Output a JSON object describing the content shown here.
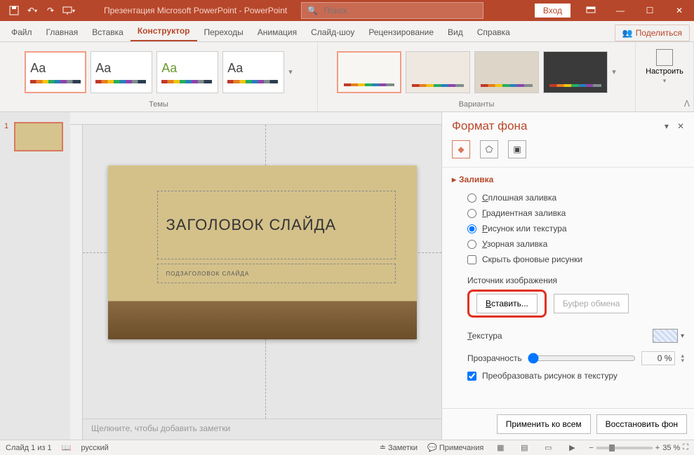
{
  "titlebar": {
    "doc_title": "Презентация Microsoft PowerPoint - PowerPoint",
    "search_placeholder": "Поиск",
    "login": "Вход"
  },
  "tabs": {
    "file": "Файл",
    "home": "Главная",
    "insert": "Вставка",
    "design": "Конструктор",
    "transitions": "Переходы",
    "animations": "Анимация",
    "slideshow": "Слайд-шоу",
    "review": "Рецензирование",
    "view": "Вид",
    "help": "Справка",
    "share": "Поделиться"
  },
  "ribbon": {
    "themes_label": "Темы",
    "variants_label": "Варианты",
    "configure": "Настроить",
    "aa": "Aa"
  },
  "slide": {
    "title": "ЗАГОЛОВОК СЛАЙДА",
    "subtitle": "ПОДЗАГОЛОВОК СЛАЙДА"
  },
  "thumbs": {
    "n1": "1"
  },
  "notes_placeholder": "Щелкните, чтобы добавить заметки",
  "pane": {
    "title": "Формат фона",
    "section_fill": "Заливка",
    "solid": "Сплошная заливка",
    "gradient": "Градиентная заливка",
    "picture": "Рисунок или текстура",
    "pattern": "Узорная заливка",
    "hide_bg": "Скрыть фоновые рисунки",
    "source": "Источник изображения",
    "insert": "Вставить...",
    "clipboard": "Буфер обмена",
    "texture": "Текстура",
    "transparency": "Прозрачность",
    "transparency_val": "0 %",
    "tile": "Преобразовать рисунок в текстуру",
    "apply_all": "Применить ко всем",
    "reset": "Восстановить фон"
  },
  "status": {
    "slide_pos": "Слайд 1 из 1",
    "lang": "русский",
    "notes": "Заметки",
    "comments": "Примечания",
    "zoom": "35 %"
  }
}
